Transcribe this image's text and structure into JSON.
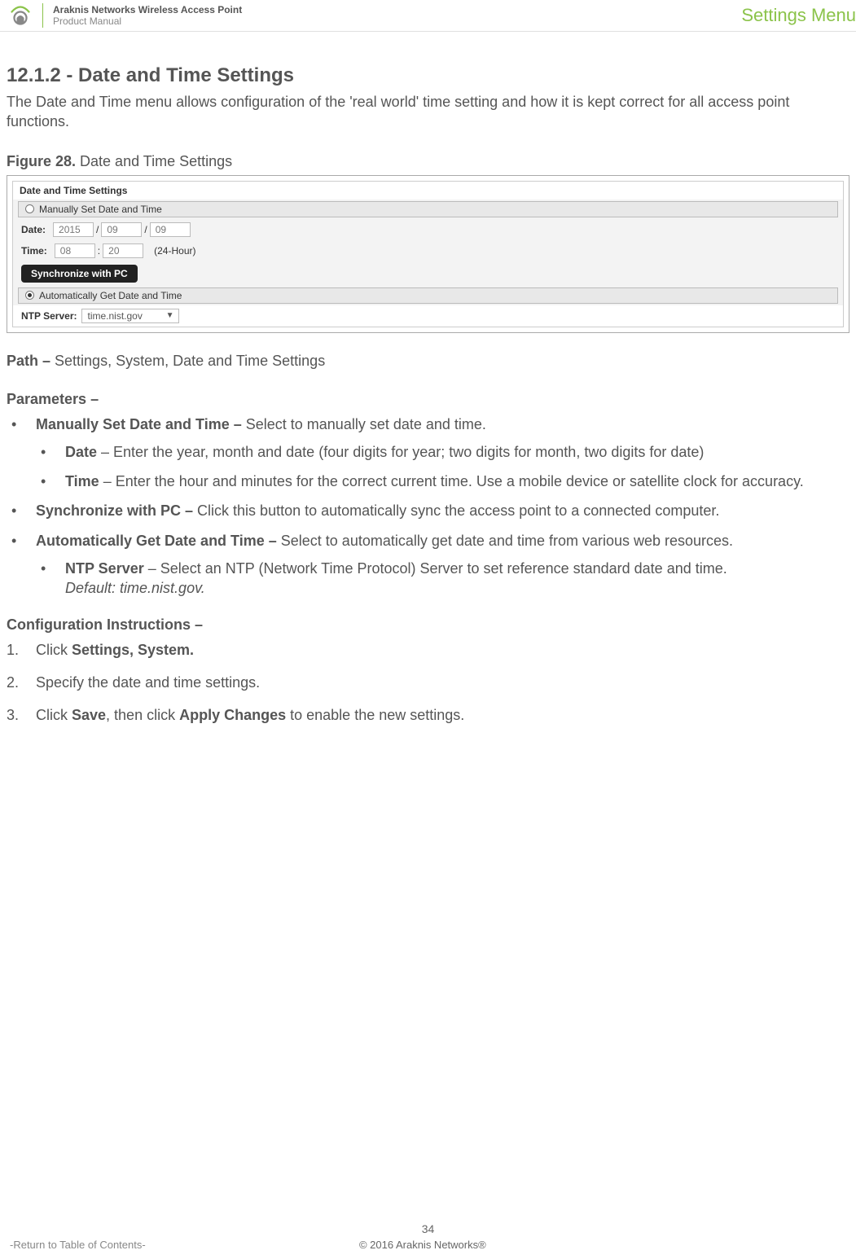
{
  "header": {
    "title": "Araknis Networks Wireless Access Point",
    "subtitle": "Product Manual",
    "menu_label": "Settings Menu"
  },
  "section": {
    "number_title": "12.1.2 - Date and Time Settings",
    "intro": "The Date and Time menu allows configuration of the 'real world' time setting and how it is kept correct for all access point functions.",
    "figure_label": "Figure 28.",
    "figure_title": " Date and Time Settings"
  },
  "screenshot": {
    "panel_title": "Date and Time Settings",
    "manual_radio": "Manually Set Date and Time",
    "date_label": "Date:",
    "date_year": "2015",
    "date_sep": "/",
    "date_month": "09",
    "date_day": "09",
    "time_label": "Time:",
    "time_hour": "08",
    "time_sep": ":",
    "time_min": "20",
    "time_note": "(24-Hour)",
    "sync_btn": "Synchronize with PC",
    "auto_radio": "Automatically Get Date and Time",
    "ntp_label": "NTP Server:",
    "ntp_value": "time.nist.gov"
  },
  "path": {
    "label": "Path – ",
    "value": "Settings, System, Date and Time Settings"
  },
  "params": {
    "heading": "Parameters –",
    "items": [
      {
        "bold": "Manually Set Date and Time – ",
        "rest": "Select to manually set date and time.",
        "sub": [
          {
            "bold": "Date",
            "rest": " – Enter the year, month and date (four digits for year; two digits for month, two digits for date)"
          },
          {
            "bold": "Time",
            "rest": " – Enter the hour and minutes for the correct current time. Use a mobile device or satellite clock for accuracy."
          }
        ]
      },
      {
        "bold": "Synchronize with PC – ",
        "rest": "Click this button to automatically sync the access point to a connected computer."
      },
      {
        "bold": "Automatically Get Date and Time – ",
        "rest": "Select to automatically get date and time from various web resources.",
        "sub": [
          {
            "bold": "NTP Server",
            "rest": " – Select an NTP (Network Time Protocol) Server to set reference standard date and time.",
            "italic": "Default: time.nist.gov."
          }
        ]
      }
    ]
  },
  "config": {
    "heading": "Configuration Instructions –",
    "steps": [
      {
        "pre": "Click ",
        "bold": "Settings, System.",
        "post": ""
      },
      {
        "pre": "Specify the date and time settings.",
        "bold": "",
        "post": ""
      },
      {
        "pre": "Click ",
        "bold": "Save",
        "mid": ", then click ",
        "bold2": "Apply Changes",
        "post": " to enable the new settings."
      }
    ]
  },
  "footer": {
    "page": "34",
    "toc": "-Return to Table of Contents-",
    "copyright": "© 2016 Araknis Networks®"
  }
}
